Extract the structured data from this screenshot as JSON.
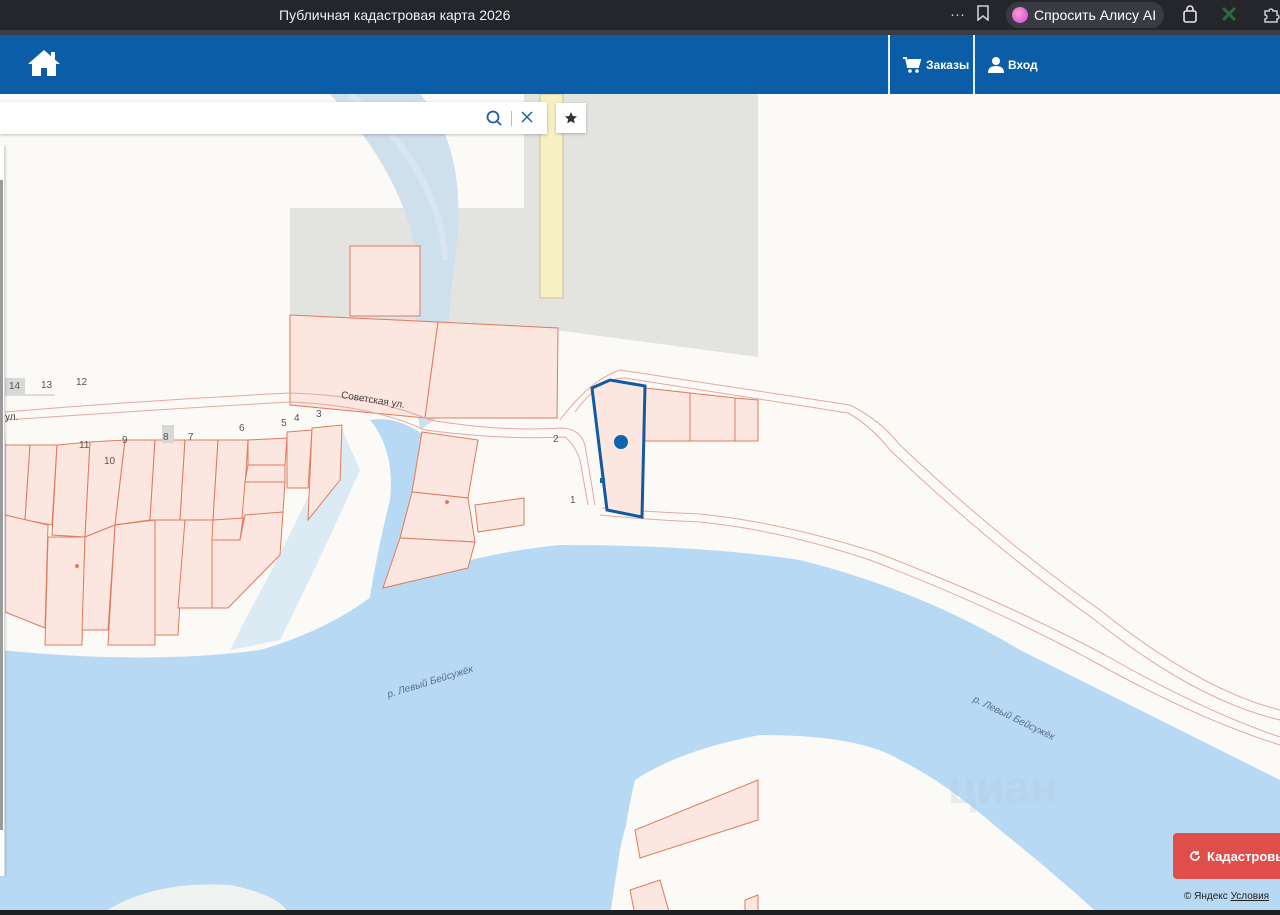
{
  "browser": {
    "title": "Публичная кадастровая карта 2026",
    "alice_label": "Спросить Алису AI",
    "more_glyph": "···"
  },
  "header": {
    "orders_label": "Заказы",
    "login_label": "Вход",
    "accent_color": "#0a5da6"
  },
  "search": {
    "value": "",
    "placeholder": ""
  },
  "map": {
    "street_label": "Советская ул.",
    "street_label_left": "ул.",
    "river_label_1": "р. Левый Бейсужёк",
    "river_label_2": "р. Левый Бейсужёк",
    "house_numbers": [
      "14",
      "13",
      "12",
      "11",
      "9",
      "10",
      "8",
      "7",
      "6",
      "5",
      "4",
      "3",
      "2",
      "1"
    ],
    "watermark": "циан"
  },
  "cadastral_button": {
    "label": "Кадастровы",
    "color": "#e04e4c"
  },
  "copyright": {
    "text": "© Яндекс",
    "link": "Условия"
  }
}
